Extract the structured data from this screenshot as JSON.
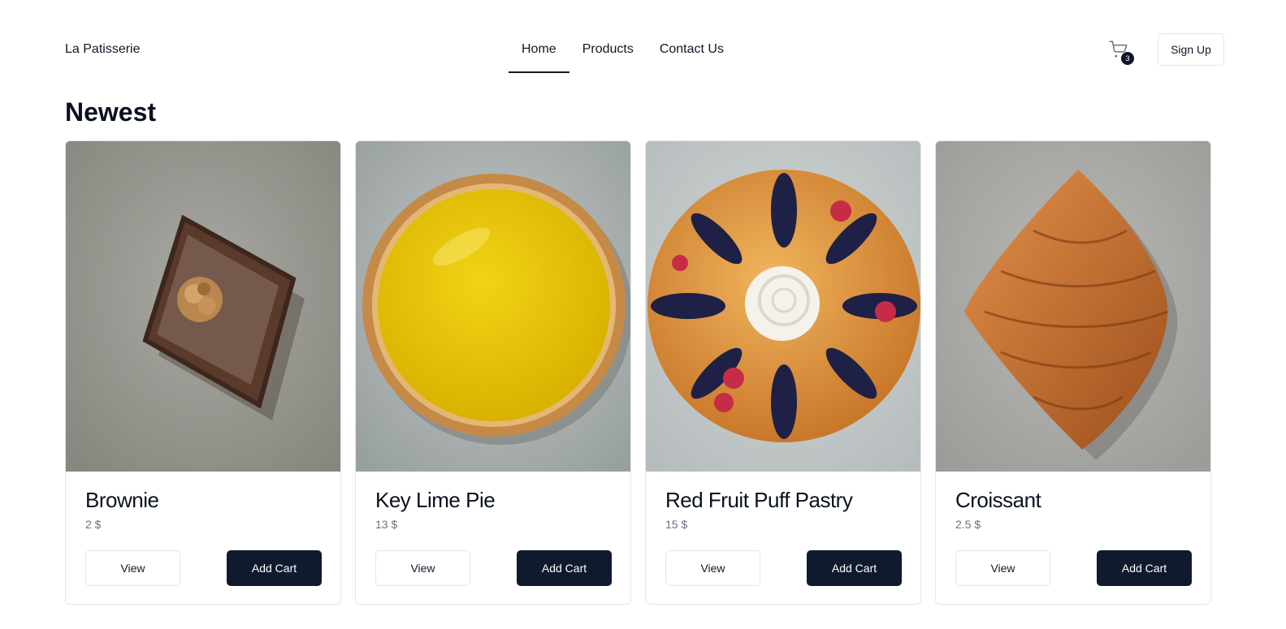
{
  "header": {
    "brand": "La Patisserie",
    "nav": [
      {
        "label": "Home",
        "active": true
      },
      {
        "label": "Products",
        "active": false
      },
      {
        "label": "Contact Us",
        "active": false
      }
    ],
    "cart_icon": "shopping-cart-icon",
    "cart_count": "3",
    "signup_label": "Sign Up"
  },
  "section": {
    "title": "Newest"
  },
  "products": [
    {
      "name": "Brownie",
      "price": "2 $",
      "view_label": "View",
      "add_label": "Add Cart",
      "image": "brownie-photo"
    },
    {
      "name": "Key Lime Pie",
      "price": "13 $",
      "view_label": "View",
      "add_label": "Add Cart",
      "image": "key-lime-pie-photo"
    },
    {
      "name": "Red Fruit Puff Pastry",
      "price": "15 $",
      "view_label": "View",
      "add_label": "Add Cart",
      "image": "red-fruit-puff-pastry-photo"
    },
    {
      "name": "Croissant",
      "price": "2.5 $",
      "view_label": "View",
      "add_label": "Add Cart",
      "image": "croissant-photo"
    }
  ],
  "colors": {
    "primary": "#101a2e",
    "border": "#e5e7eb",
    "muted_text": "#6b7280"
  }
}
